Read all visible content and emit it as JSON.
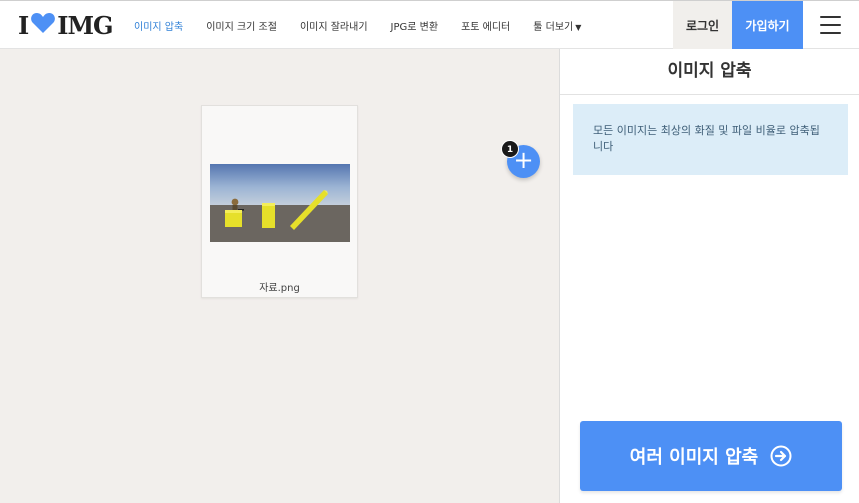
{
  "brand": {
    "logo_left": "I",
    "logo_right": "IMG",
    "heart_color": "#4d90f5"
  },
  "nav": {
    "items": [
      {
        "label": "이미지 압축",
        "active": true
      },
      {
        "label": "이미지 크기 조절"
      },
      {
        "label": "이미지 잘라내기"
      },
      {
        "label": "JPG로 변환"
      },
      {
        "label": "포토 에디터"
      },
      {
        "label": "툴 더보기"
      }
    ],
    "more_icon": "caret-down-icon"
  },
  "auth": {
    "login_label": "로그인",
    "signup_label": "가입하기"
  },
  "menu_icon": "hamburger-icon",
  "workspace": {
    "files": [
      {
        "name": "자료.png"
      }
    ],
    "add_button_label": "+",
    "file_count_badge": "1"
  },
  "sidebar": {
    "title": "이미지 압축",
    "info_text": "모든 이미지는 최상의 화질 및 파일 비율로 압축됩니다",
    "action_button_label": "여러 이미지 압축",
    "action_icon": "arrow-right-circle-icon"
  },
  "colors": {
    "accent": "#4d90f5",
    "nav_active": "#2e7fd6",
    "info_bg": "#dcedf8",
    "workspace_bg": "#f2efec"
  }
}
